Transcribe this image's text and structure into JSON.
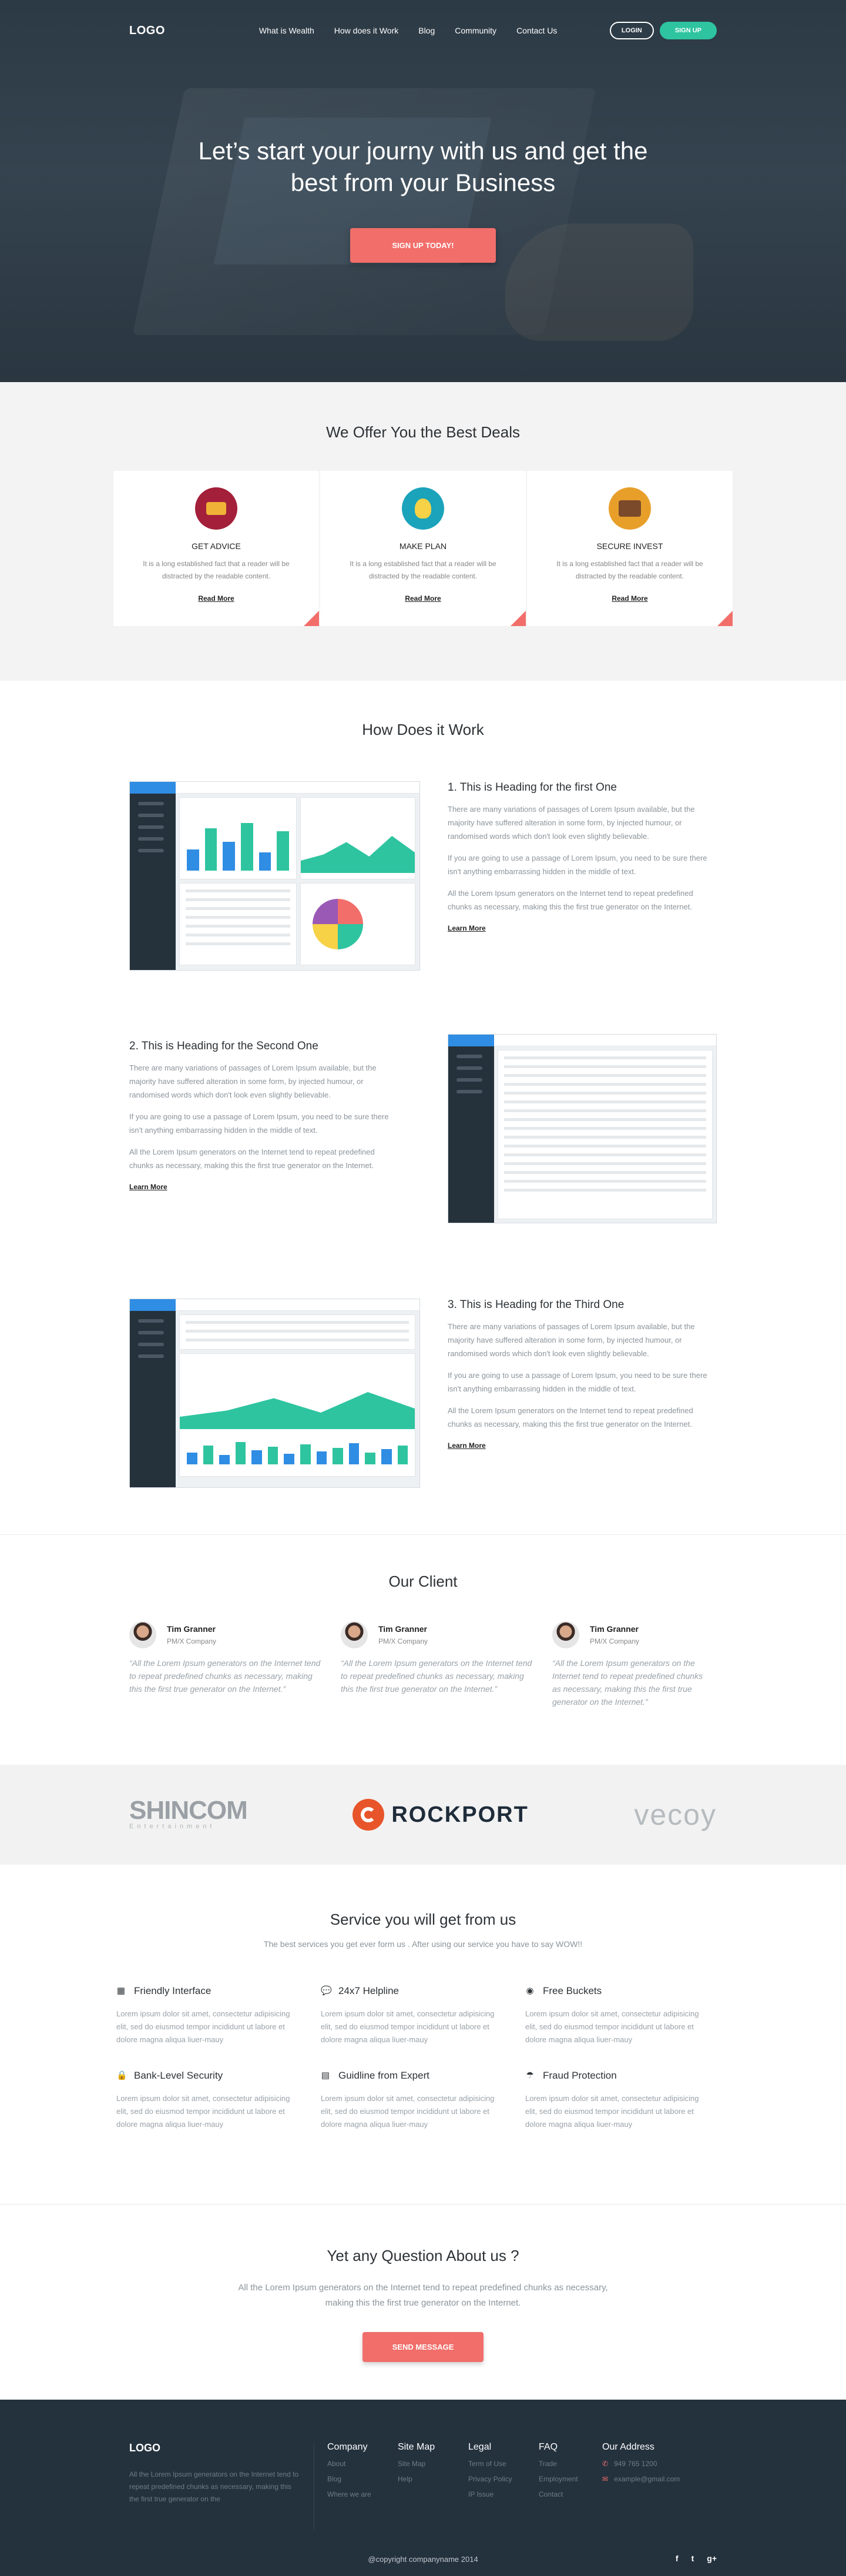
{
  "nav": {
    "logo": "LOGO",
    "menu": [
      "What is Wealth",
      "How does it Work",
      "Blog",
      "Community",
      "Contact Us"
    ],
    "login": "LOGIN",
    "signup": "SIGN UP"
  },
  "hero": {
    "title_line1": "Let’s start your journy with us and get the",
    "title_line2": "best from your Business",
    "cta": "SIGN UP TODAY!"
  },
  "deals": {
    "title": "We Offer You the Best Deals",
    "cards": [
      {
        "title": "GET ADVICE",
        "text": "It is a long established fact that a reader will be distracted by the readable content.",
        "link": "Read More",
        "icon": "advice-icon"
      },
      {
        "title": "MAKE PLAN",
        "text": "It is a long established fact that a reader will be distracted by the readable content.",
        "link": "Read More",
        "icon": "lightbulb-icon"
      },
      {
        "title": "SECURE INVEST",
        "text": "It is a long established fact that a reader will be distracted by the readable content.",
        "link": "Read More",
        "icon": "briefcase-icon"
      }
    ]
  },
  "how": {
    "title": "How Does it Work",
    "items": [
      {
        "heading": "1. This is Heading for the first One",
        "p1": "There are many variations of passages of Lorem Ipsum available, but the majority have suffered alteration in some form, by injected humour, or randomised words which don't look even slightly believable.",
        "p2": "If you are going to use a passage of Lorem Ipsum, you need to be sure there isn't anything embarrassing hidden in the middle of text.",
        "p3": "All the Lorem Ipsum generators on the Internet tend to repeat predefined chunks as necessary, making this the first true generator on the Internet.",
        "link": "Learn More"
      },
      {
        "heading": "2. This is Heading for the Second One",
        "p1": "There are many variations of passages of Lorem Ipsum available, but the majority have suffered alteration in some form, by injected humour, or randomised words which don't look even slightly believable.",
        "p2": "If you are going to use a passage of Lorem Ipsum, you need to be sure there isn't anything embarrassing hidden in the middle of text.",
        "p3": "All the Lorem Ipsum generators on the Internet tend to repeat predefined chunks as necessary, making this the first true generator on the Internet.",
        "link": "Learn More"
      },
      {
        "heading": "3. This is Heading for the Third One",
        "p1": "There are many variations of passages of Lorem Ipsum available, but the majority have suffered alteration in some form, by injected humour, or randomised words which don't look even slightly believable.",
        "p2": "If you are going to use a passage of Lorem Ipsum, you need to be sure there isn't anything embarrassing hidden in the middle of text.",
        "p3": "All the Lorem Ipsum generators on the Internet tend to repeat predefined chunks as necessary, making this the first true generator on the Internet.",
        "link": "Learn More"
      }
    ]
  },
  "client": {
    "title": "Our Client",
    "testimonials": [
      {
        "name": "Tim Granner",
        "role": "PM/X Company",
        "quote": "“All the Lorem Ipsum generators on the Internet tend to repeat predefined chunks as necessary, making this the first true generator on the Internet.”"
      },
      {
        "name": "Tim Granner",
        "role": "PM/X Company",
        "quote": "“All the Lorem Ipsum generators on the Internet tend to repeat predefined chunks as necessary, making this the first true generator on the Internet.”"
      },
      {
        "name": "Tim Granner",
        "role": "PM/X Company",
        "quote": "“All the Lorem Ipsum generators on the Internet tend to repeat predefined chunks as necessary, making this the first true generator on the Internet.”"
      }
    ]
  },
  "logos": {
    "shincom": "SHINCOM",
    "shincom_sub": "Entertainment",
    "rockport": "ROCKPORT",
    "vecoy": "vecoy"
  },
  "services": {
    "title": "Service you will get from us",
    "subtitle": "The best services you get ever form us . After using our service you have to say WOW!!",
    "items": [
      {
        "title": "Friendly Interface",
        "icon": "grid-icon",
        "glyph": "▦",
        "text": "Lorem ipsum dolor sit amet, consectetur adipisicing elit, sed do eiusmod tempor incididunt ut labore et dolore magna aliqua liuer-mauy"
      },
      {
        "title": "24x7 Helpline",
        "icon": "chat-icon",
        "glyph": "💬",
        "text": "Lorem ipsum dolor sit amet, consectetur adipisicing elit, sed do eiusmod tempor incididunt ut labore et dolore magna aliqua liuer-mauy"
      },
      {
        "title": "Free Buckets",
        "icon": "coin-icon",
        "glyph": "◉",
        "text": "Lorem ipsum dolor sit amet, consectetur adipisicing elit, sed do eiusmod tempor incididunt ut labore et dolore magna aliqua liuer-mauy"
      },
      {
        "title": "Bank-Level Security",
        "icon": "lock-icon",
        "glyph": "🔒",
        "text": "Lorem ipsum dolor sit amet, consectetur adipisicing elit, sed do eiusmod tempor incididunt ut labore et dolore magna aliqua liuer-mauy"
      },
      {
        "title": "Guidline from  Expert",
        "icon": "document-icon",
        "glyph": "▤",
        "text": "Lorem ipsum dolor sit amet, consectetur adipisicing elit, sed do eiusmod tempor incididunt ut labore et dolore magna aliqua liuer-mauy"
      },
      {
        "title": "Fraud Protection",
        "icon": "umbrella-icon",
        "glyph": "☂",
        "text": "Lorem ipsum dolor sit amet, consectetur adipisicing elit, sed do eiusmod tempor incididunt ut labore et dolore magna aliqua liuer-mauy"
      }
    ]
  },
  "question": {
    "title": "Yet any Question About us ?",
    "text": "All the Lorem Ipsum generators on the Internet tend to repeat predefined chunks as necessary, making this the first true generator on the Internet.",
    "button": "SEND MESSAGE"
  },
  "footer": {
    "logo": "LOGO",
    "about": "All the Lorem Ipsum generators on the Internet tend to repeat predefined chunks as necessary, making this the first true generator on the",
    "columns": [
      {
        "title": "Company",
        "links": [
          "About",
          "Blog",
          "Where we are"
        ]
      },
      {
        "title": "Site Map",
        "links": [
          "Site Map",
          "Help"
        ]
      },
      {
        "title": "Legal",
        "links": [
          "Term of Use",
          "Privacy Policy",
          "IP Issue"
        ]
      },
      {
        "title": "FAQ",
        "links": [
          "Trade",
          "Employment",
          "Contact"
        ]
      }
    ],
    "address_title": "Our Address",
    "phone": "949 765 1200",
    "email": "example@gmail.com",
    "copyright": "@copyright companyname 2014",
    "social": [
      "f",
      "t",
      "g+"
    ]
  },
  "colors": {
    "accent": "#f16e6a",
    "green": "#2ec4a0",
    "dark": "#24323e",
    "blue": "#2f8de4"
  }
}
